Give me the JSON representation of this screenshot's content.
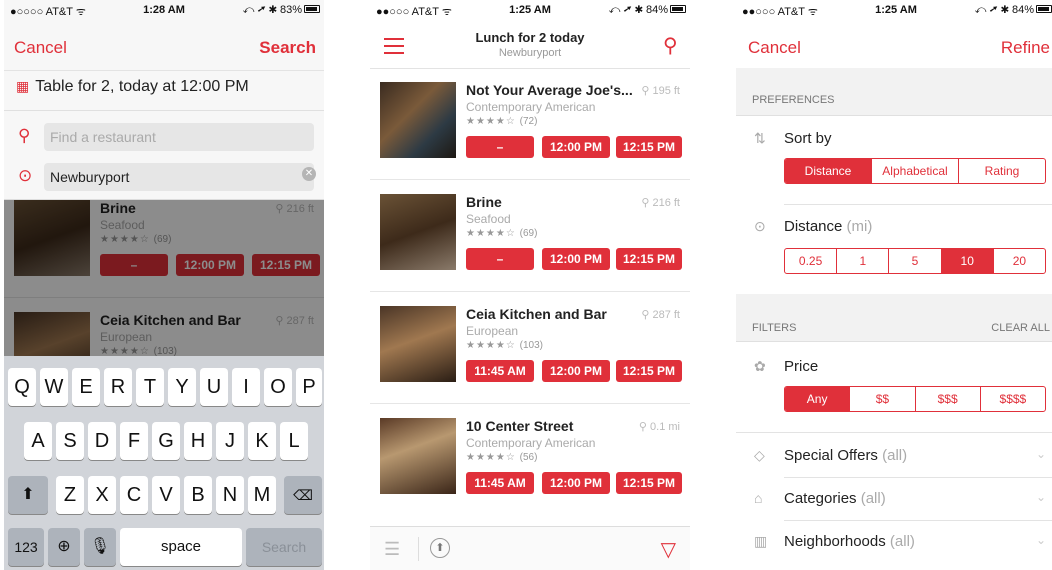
{
  "phone1": {
    "status": {
      "carrier": "●○○○○ AT&T ᯤ",
      "time": "1:28 AM",
      "battery": "⤺ ➚ ✱ 83%"
    },
    "nav": {
      "cancel": "Cancel",
      "search": "Search"
    },
    "table_for": "Table for 2, today at 12:00 PM",
    "search_placeholder": "Find a restaurant",
    "location_value": "Newburyport",
    "dimmed_items": [
      {
        "name": "Brine",
        "cuisine": "Seafood",
        "rating": "(69)",
        "distance": "216 ft",
        "slots": [
          "–",
          "12:00 PM",
          "12:15 PM"
        ]
      },
      {
        "name": "Ceia Kitchen and Bar",
        "cuisine": "European",
        "rating": "(103)",
        "distance": "287 ft"
      }
    ],
    "keyboard": {
      "row1": [
        "Q",
        "W",
        "E",
        "R",
        "T",
        "Y",
        "U",
        "I",
        "O",
        "P"
      ],
      "row2": [
        "A",
        "S",
        "D",
        "F",
        "G",
        "H",
        "J",
        "K",
        "L"
      ],
      "row3": [
        "Z",
        "X",
        "C",
        "V",
        "B",
        "N",
        "M"
      ],
      "num": "123",
      "space": "space",
      "search": "Search"
    }
  },
  "phone2": {
    "status": {
      "carrier": "●●○○○ AT&T ᯤ",
      "time": "1:25 AM",
      "battery": "⤺ ➚ ✱ 84%"
    },
    "nav": {
      "title": "Lunch for 2 today",
      "subtitle": "Newburyport"
    },
    "items": [
      {
        "name": "Not Your Average Joe's...",
        "cuisine": "Contemporary American",
        "rating": "(72)",
        "distance": "195 ft",
        "slots": [
          "–",
          "12:00 PM",
          "12:15 PM"
        ]
      },
      {
        "name": "Brine",
        "cuisine": "Seafood",
        "rating": "(69)",
        "distance": "216 ft",
        "slots": [
          "–",
          "12:00 PM",
          "12:15 PM"
        ]
      },
      {
        "name": "Ceia Kitchen and Bar",
        "cuisine": "European",
        "rating": "(103)",
        "distance": "287 ft",
        "slots": [
          "11:45 AM",
          "12:00 PM",
          "12:15 PM"
        ]
      },
      {
        "name": "10 Center Street",
        "cuisine": "Contemporary American",
        "rating": "(56)",
        "distance": "0.1 mi",
        "slots": [
          "11:45 AM",
          "12:00 PM",
          "12:15 PM"
        ]
      }
    ]
  },
  "phone3": {
    "status": {
      "carrier": "●●○○○ AT&T ᯤ",
      "time": "1:25 AM",
      "battery": "⤺ ➚ ✱ 84%"
    },
    "nav": {
      "cancel": "Cancel",
      "refine": "Refine"
    },
    "preferences": "PREFERENCES",
    "sort_by": "Sort by",
    "sort_options": [
      "Distance",
      "Alphabetical",
      "Rating"
    ],
    "distance_label": "Distance",
    "distance_unit": "(mi)",
    "distance_options": [
      "0.25",
      "1",
      "5",
      "10",
      "20"
    ],
    "filters": "FILTERS",
    "clear_all": "CLEAR ALL",
    "price": "Price",
    "price_options": [
      "Any",
      "$$",
      "$$$",
      "$$$$"
    ],
    "rows": [
      {
        "label": "Special Offers",
        "value": "(all)"
      },
      {
        "label": "Categories",
        "value": "(all)"
      },
      {
        "label": "Neighborhoods",
        "value": "(all)"
      }
    ]
  }
}
